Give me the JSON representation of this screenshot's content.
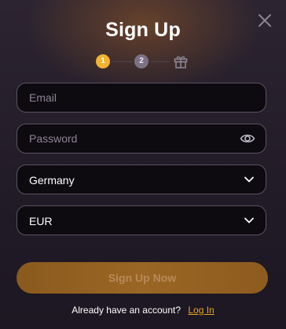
{
  "dialog": {
    "title": "Sign Up",
    "close_icon": "close-icon"
  },
  "steps": {
    "items": [
      {
        "label": "1",
        "state": "active",
        "color": "#f3b32f"
      },
      {
        "label": "2",
        "state": "pending",
        "color": "#7b7286"
      }
    ],
    "final_icon": "gift-icon"
  },
  "form": {
    "email": {
      "placeholder": "Email",
      "value": ""
    },
    "password": {
      "placeholder": "Password",
      "value": "",
      "toggle_icon": "eye-icon"
    },
    "country": {
      "value": "Germany",
      "icon": "chevron-down-icon"
    },
    "currency": {
      "value": "EUR",
      "icon": "chevron-down-icon"
    },
    "submit_label": "Sign Up Now"
  },
  "footer": {
    "prompt": "Already have an account?",
    "link_label": "Log In"
  },
  "colors": {
    "accent": "#e9a323",
    "button": "#9a6624",
    "background": "#241e2a"
  }
}
